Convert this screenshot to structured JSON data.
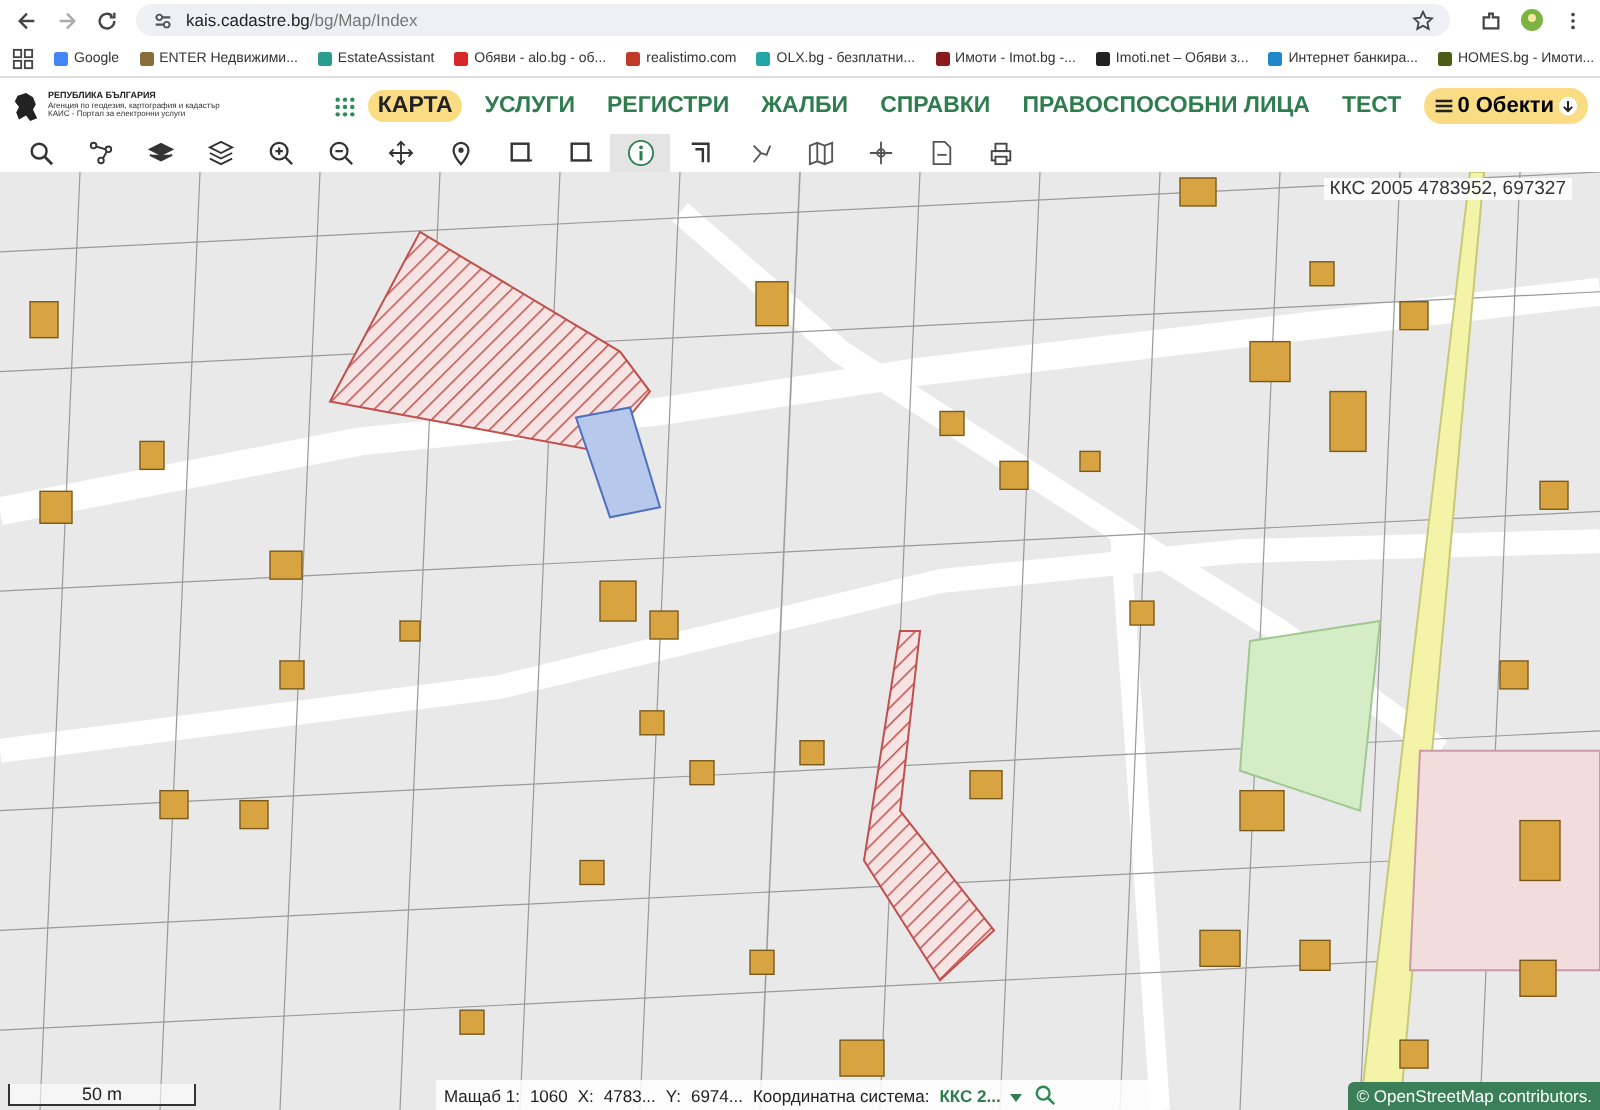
{
  "browser": {
    "url_host": "kais.cadastre.bg",
    "url_path": "/bg/Map/Index",
    "bookmarks": [
      {
        "label": "Google"
      },
      {
        "label": "ENTER Недвижими..."
      },
      {
        "label": "EstateAssistant"
      },
      {
        "label": "Обяви - alo.bg - об..."
      },
      {
        "label": "realistimo.com"
      },
      {
        "label": "OLX.bg - безплатни..."
      },
      {
        "label": "Имоти - Imot.bg -..."
      },
      {
        "label": "Imoti.net – Обяви з..."
      },
      {
        "label": "Интернет банкира..."
      },
      {
        "label": "HOMES.bg - Имоти..."
      }
    ]
  },
  "header": {
    "logo_lines": [
      "РЕПУБЛИКА БЪЛГАРИЯ",
      "Агенция по геодезия, картография и кадастър",
      "КАИС - Портал за електронни услуги"
    ],
    "nav": [
      {
        "label": "КАРТА",
        "selected": true
      },
      {
        "label": "УСЛУГИ",
        "selected": false
      },
      {
        "label": "РЕГИСТРИ",
        "selected": false
      },
      {
        "label": "ЖАЛБИ",
        "selected": false
      },
      {
        "label": "СПРАВКИ",
        "selected": false
      },
      {
        "label": "ПРАВОСПОСОБНИ ЛИЦА",
        "selected": false
      },
      {
        "label": "ТЕСТ",
        "selected": false
      }
    ],
    "objects_button": "0 Обекти"
  },
  "toolbar": [
    {
      "selected": false
    },
    {
      "selected": false
    },
    {
      "selected": false
    },
    {
      "selected": false
    },
    {
      "selected": false
    },
    {
      "selected": false
    },
    {
      "selected": false
    },
    {
      "selected": false
    },
    {
      "selected": false
    },
    {
      "selected": false
    },
    {
      "selected": true
    },
    {
      "selected": false
    },
    {
      "selected": false
    },
    {
      "selected": false
    },
    {
      "selected": false
    },
    {
      "selected": false
    },
    {
      "selected": false
    }
  ],
  "map": {
    "coordinates": "ККС 2005 4783952, 697327",
    "scale_bar": "50 m",
    "attribution": "© OpenStreetMap contributors."
  },
  "status_bar": {
    "scale_label": "Мащаб 1:",
    "scale_value": "1060",
    "x_label": "X:",
    "x_value": "4783...",
    "y_label": "Y:",
    "y_value": "6974...",
    "crs_label": "Координатна система:",
    "crs_value": "ККС 2..."
  }
}
